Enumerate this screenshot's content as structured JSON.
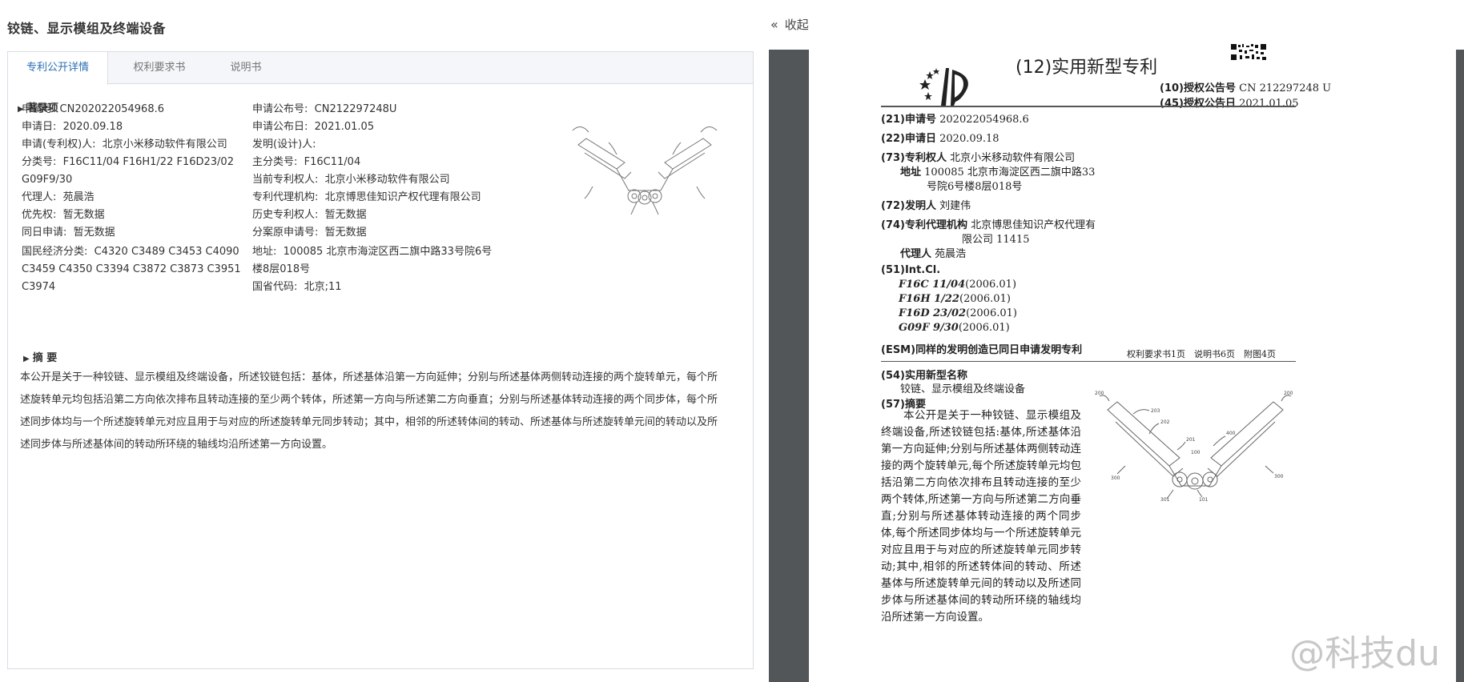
{
  "title": "铰链、显示模组及终端设备",
  "collapse": {
    "icon": "double-chevron-left-icon",
    "label": "收起"
  },
  "tabs": [
    {
      "label": "专利公开详情",
      "active": true
    },
    {
      "label": "权利要求书",
      "active": false
    },
    {
      "label": "说明书",
      "active": false
    }
  ],
  "biblio": {
    "heading": "著录项",
    "application_no": {
      "label": "申请号:",
      "value": "CN202022054968.6"
    },
    "publication_no": {
      "label": "申请公布号:",
      "value": "CN212297248U"
    },
    "application_date": {
      "label": "申请日:",
      "value": "2020.09.18"
    },
    "publication_date": {
      "label": "申请公布日:",
      "value": "2021.01.05"
    },
    "applicant": {
      "label": "申请(专利权)人:",
      "value": "北京小米移动软件有限公司"
    },
    "inventor": {
      "label": "发明(设计)人:",
      "value": ""
    },
    "classification": {
      "label": "分类号:",
      "value_line1": "F16C11/04 F16H1/22 F16D23/02",
      "value_line2": "G09F9/30"
    },
    "main_class": {
      "label": "主分类号:",
      "value": "F16C11/04"
    },
    "current_holder": {
      "label": "当前专利权人:",
      "value": "北京小米移动软件有限公司"
    },
    "agent": {
      "label": "代理人:",
      "value": "苑晨浩"
    },
    "agency": {
      "label": "专利代理机构:",
      "value": "北京博思佳知识产权代理有限公司"
    },
    "priority": {
      "label": "优先权:",
      "value": "暂无数据"
    },
    "history_holder": {
      "label": "历史专利权人:",
      "value": "暂无数据"
    },
    "same_day": {
      "label": "同日申请:",
      "value": "暂无数据"
    },
    "divisional": {
      "label": "分案原申请号:",
      "value": "暂无数据"
    },
    "economy_class": {
      "label": "国民经济分类:",
      "line1": "C4320 C3489 C3453 C4090",
      "line2": "C3459 C4350 C3394 C3872 C3873 C3951",
      "line3": "C3974"
    },
    "address": {
      "label": "地址:",
      "line1": "100085 北京市海淀区西二旗中路33号院6号",
      "line2": "楼8层018号"
    },
    "province_code": {
      "label": "国省代码:",
      "value": "北京;11"
    }
  },
  "abstract": {
    "heading": "摘 要",
    "text": "本公开是关于一种铰链、显示模组及终端设备，所述铰链包括：基体，所述基体沿第一方向延伸；分别与所述基体两侧转动连接的两个旋转单元，每个所述旋转单元均包括沿第二方向依次排布且转动连接的至少两个转体，所述第一方向与所述第二方向垂直；分别与所述基体转动连接的两个同步体，每个所述同步体均与一个所述旋转单元对应且用于与对应的所述旋转单元同步转动；其中，相邻的所述转体间的转动、所述基体与所述旋转单元间的转动以及所述同步体与所述基体间的转动所环绕的轴线均沿所述第一方向设置。"
  },
  "doc": {
    "title": "(12)实用新型专利",
    "grant_no": {
      "label": "(10)授权公告号",
      "value": "CN 212297248 U"
    },
    "grant_date": {
      "label": "(45)授权公告日",
      "value": "2021.01.05"
    },
    "app_no": {
      "label": "(21)申请号",
      "value": "202022054968.6"
    },
    "app_date": {
      "label": "(22)申请日",
      "value": "2020.09.18"
    },
    "holder": {
      "label": "(73)专利权人",
      "value": "北京小米移动软件有限公司"
    },
    "address": {
      "label": "地址",
      "line1": "100085 北京市海淀区西二旗中路33",
      "line2": "号院6号楼8层018号"
    },
    "inventor": {
      "label": "(72)发明人",
      "value": "刘建伟"
    },
    "agency": {
      "label": "(74)专利代理机构",
      "line1": "北京博思佳知识产权代理有",
      "line2": "限公司 11415"
    },
    "agent": {
      "label": "代理人",
      "value": "苑晨浩"
    },
    "intcl": {
      "label": "(51)Int.Cl.",
      "items": [
        {
          "code": "F16C 11/04",
          "ver": "(2006.01)"
        },
        {
          "code": "F16H 1/22",
          "ver": "(2006.01)"
        },
        {
          "code": "F16D 23/02",
          "ver": "(2006.01)"
        },
        {
          "code": "G09F 9/30",
          "ver": "(2006.01)"
        }
      ]
    },
    "esm": "(ESM)同样的发明创造已同日申请发明专利",
    "pages": "权利要求书1页　说明书6页　附图4页",
    "name": {
      "label": "(54)实用新型名称",
      "value": "铰链、显示模组及终端设备"
    },
    "abstract_label": "(57)摘要",
    "abstract": "本公开是关于一种铰链、显示模组及终端设备,所述铰链包括:基体,所述基体沿第一方向延伸;分别与所述基体两侧转动连接的两个旋转单元,每个所述旋转单元均包括沿第二方向依次排布且转动连接的至少两个转体,所述第一方向与所述第二方向垂直;分别与所述基体转动连接的两个同步体,每个所述同步体均与一个所述旋转单元对应且用于与对应的所述旋转单元同步转动;其中,相邻的所述转体间的转动、所述基体与所述旋转单元间的转动以及所述同步体与所述基体间的转动所环绕的轴线均沿所述第一方向设置。",
    "figure_labels": [
      "200",
      "203",
      "202",
      "201",
      "100",
      "400",
      "300",
      "300",
      "301",
      "101",
      "200"
    ]
  },
  "watermark": "@科技du"
}
